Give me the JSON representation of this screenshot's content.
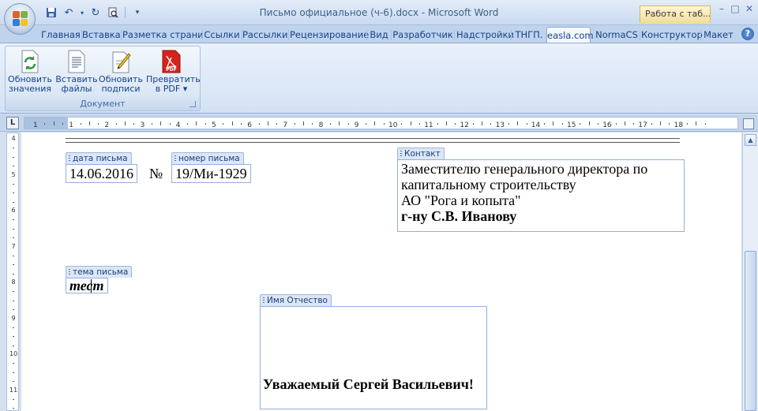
{
  "window": {
    "title": "Письмо официальное (ч-6).docx - Microsoft Word",
    "context_tab": "Работа с таб..."
  },
  "controls": {
    "minimize": "–",
    "maximize": "□",
    "close": "✕"
  },
  "tabs": [
    "Главная",
    "Вставка",
    "Разметка страни",
    "Ссылки",
    "Рассылки",
    "Рецензирование",
    "Вид",
    "Разработчик",
    "Надстройки",
    "ТНГП.",
    "easla.com",
    "NormaCS",
    "Конструктор",
    "Макет"
  ],
  "active_tab": "easla.com",
  "ribbon": {
    "group_label": "Документ",
    "buttons": [
      {
        "line1": "Обновить",
        "line2": "значения",
        "icon": "refresh-icon"
      },
      {
        "line1": "Вставить",
        "line2": "файлы",
        "icon": "document-icon"
      },
      {
        "line1": "Обновить",
        "line2": "подписи",
        "icon": "pencil-icon"
      },
      {
        "line1": "Превратить",
        "line2": "в PDF ▾",
        "icon": "pdf-icon"
      }
    ]
  },
  "ruler": {
    "ticks": [
      "1",
      "1",
      "2",
      "3",
      "4",
      "5",
      "6",
      "7",
      "8",
      "9",
      "10",
      "11",
      "12",
      "13",
      "14",
      "15",
      "16",
      "17",
      "18"
    ],
    "corner": "L"
  },
  "vruler": {
    "ticks": [
      "4",
      "5",
      "6",
      "7",
      "8",
      "9",
      "10",
      "11"
    ]
  },
  "document": {
    "date_tag": "дата письма",
    "date_value": "14.06.2016",
    "number_sign": "№",
    "number_tag": "номер письма",
    "number_value": "19/Ми-1929",
    "contact_tag": "Контакт",
    "contact_lines": [
      "Заместителю генерального директора по",
      "капитальному строительству",
      "АО \"Рога и копыта\"",
      "г-ну С.В. Иванову"
    ],
    "subject_tag": "тема письма",
    "subject_value": "тест",
    "name_tag": "Имя Отчество",
    "greeting": "Уважаемый Сергей Васильевич!"
  },
  "colors": {
    "accent": "#15428b",
    "cc_border": "#8fb0df",
    "pdf_red": "#d4241c"
  }
}
